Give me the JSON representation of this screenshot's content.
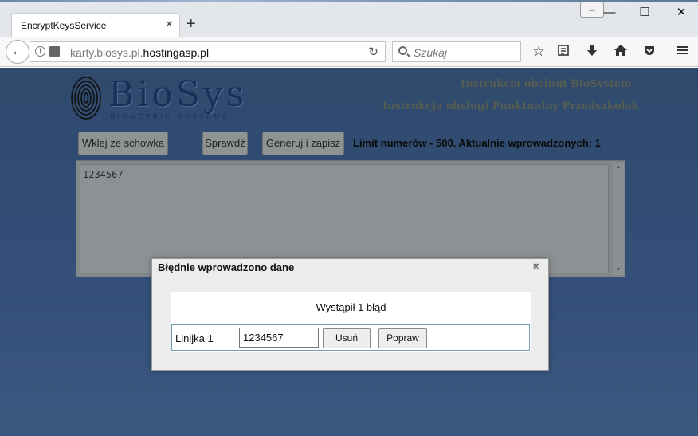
{
  "browser": {
    "tab_title": "EncryptKeysService",
    "tab_close": "×",
    "new_tab": "+",
    "window": {
      "resize_tip": "⇔",
      "minimize": "—",
      "maximize": "☐",
      "close": "✕"
    },
    "url_prefix": "karty.biosys.pl.",
    "url_domain": "hostingasp.pl",
    "search_placeholder": "Szukaj",
    "toolbar_icons": [
      "star-icon",
      "reading-list-icon",
      "download-icon",
      "home-icon",
      "pocket-icon",
      "menu-icon"
    ]
  },
  "page": {
    "logo": {
      "name": "BioSys",
      "subtitle": "BIOMETRIC SYSTEMS"
    },
    "links": {
      "biosystem": "Instrukcja obslugi BioSystem",
      "przedszkolak": "Instrukcja obslugi Punktualny Przedszkolak"
    },
    "buttons": {
      "paste": "Wklej ze schowka",
      "check": "Sprawdź",
      "generate": "Generuj i zapisz"
    },
    "limit_text": "Limit numerów - 500. Aktualnie wprowadzonych: 1",
    "textarea_value": "1234567"
  },
  "dialog": {
    "title": "Błędnie wprowadzono dane",
    "close": "⊠",
    "message": "Wystąpił 1 błąd",
    "row": {
      "label": "Linijka 1",
      "value": "1234567",
      "delete_label": "Usuń",
      "fix_label": "Popraw"
    }
  },
  "colors": {
    "page_bg": "#34507a",
    "link": "#555d52",
    "dialog_row_border": "#6d9fb1"
  }
}
